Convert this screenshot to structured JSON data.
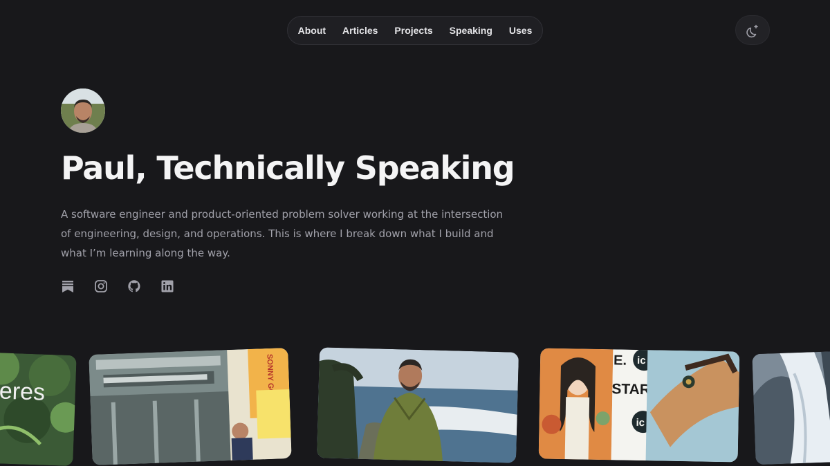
{
  "nav": {
    "items": [
      {
        "label": "About"
      },
      {
        "label": "Articles"
      },
      {
        "label": "Projects"
      },
      {
        "label": "Speaking"
      },
      {
        "label": "Uses"
      }
    ]
  },
  "theme_toggle": {
    "icon": "moon-star-icon"
  },
  "hero": {
    "title": "Paul, Technically Speaking",
    "intro": "A software engineer and product-oriented problem solver working at the intersection of engineering, design, and operations. This is where I break down what I build and what I’m learning along the way."
  },
  "socials": [
    {
      "icon": "substack-icon"
    },
    {
      "icon": "instagram-icon"
    },
    {
      "icon": "github-icon"
    },
    {
      "icon": "linkedin-icon"
    }
  ],
  "photos": {
    "p1_text": "eres",
    "p2_sign": "SONNY GOOD",
    "p4_text": "START HE",
    "p4_letter": "E.",
    "p4_ic": "ic"
  },
  "colors": {
    "background": "#18181b",
    "text": "#f4f4f5",
    "muted": "#a1a1aa"
  }
}
